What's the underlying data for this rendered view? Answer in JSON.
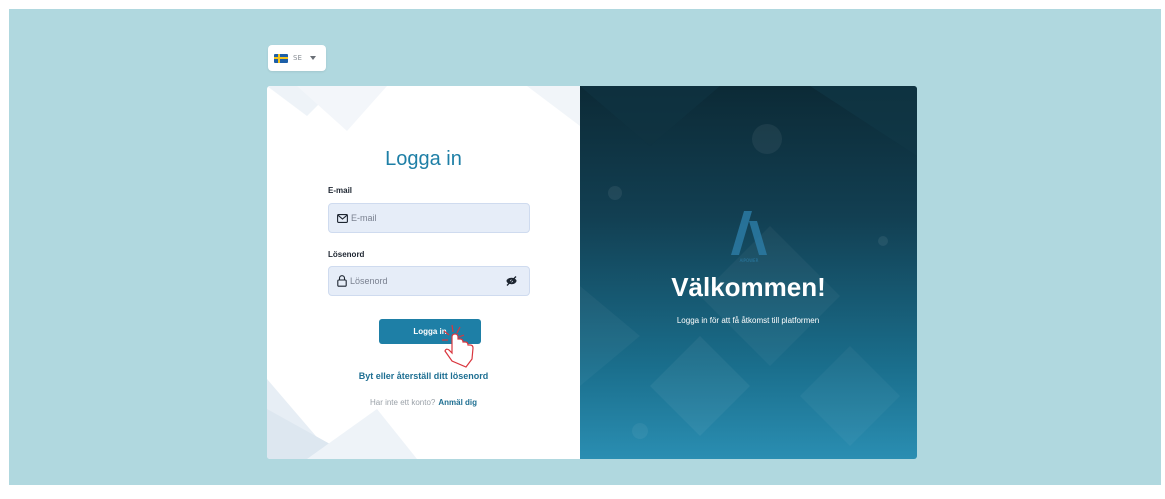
{
  "language": {
    "code": "SE",
    "flag_icon": "sweden-flag-icon"
  },
  "login": {
    "title": "Logga in",
    "email_label": "E-mail",
    "email_placeholder": "E-mail",
    "password_label": "Lösenord",
    "password_placeholder": "Lösenord",
    "submit_label": "Logga in",
    "reset_link": "Byt eller återställ ditt lösenord",
    "signup_question": "Har inte ett konto?",
    "signup_link": "Anmäl dig"
  },
  "welcome": {
    "title": "Välkommen!",
    "subtitle": "Logga in för att få åtkomst till platformen",
    "logo_text": "AIPOWER"
  },
  "colors": {
    "accent": "#1e7fa6",
    "page_background": "#b0d8df",
    "panel_dark": "#0c2a36",
    "panel_light": "#2a8eb2"
  }
}
